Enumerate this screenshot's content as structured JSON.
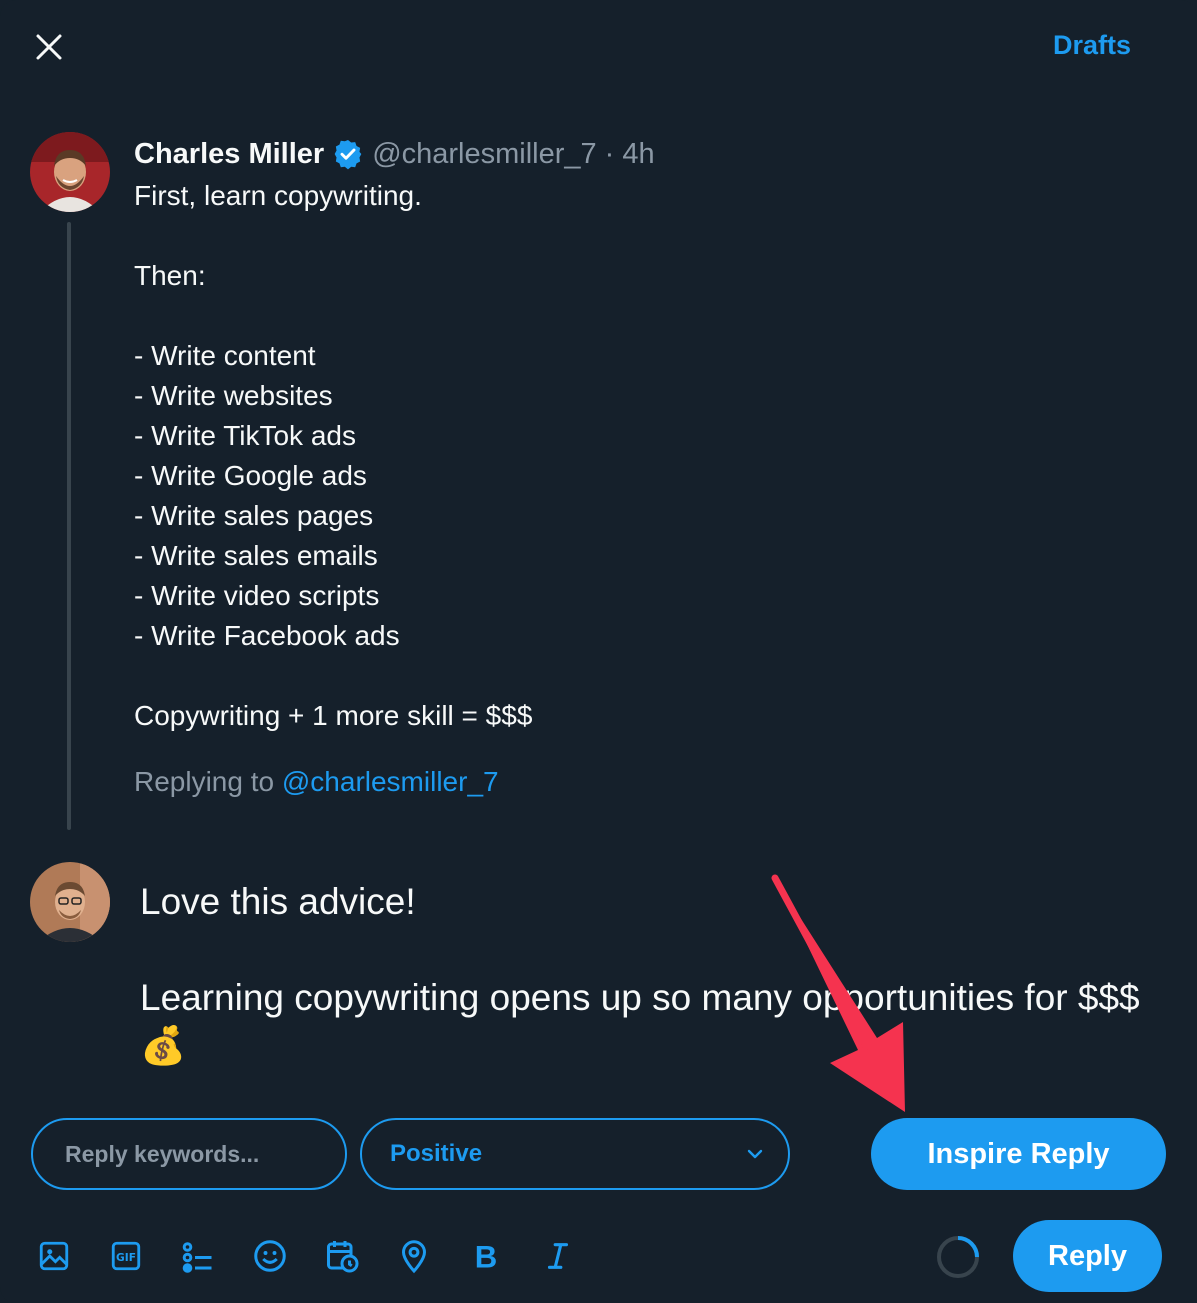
{
  "header": {
    "close_icon": "close-icon",
    "drafts_label": "Drafts"
  },
  "tweet": {
    "name": "Charles Miller",
    "verified_icon": "verified-badge-icon",
    "handle": "@charlesmiller_7",
    "dot": "·",
    "time": "4h",
    "lines": [
      "First, learn copywriting.",
      "",
      "Then:",
      "",
      "- Write content",
      "- Write websites",
      "- Write TikTok ads",
      "- Write Google ads",
      "- Write sales pages",
      "- Write sales emails",
      "- Write video scripts",
      "- Write Facebook ads",
      "",
      "Copywriting + 1 more skill = $$$"
    ],
    "replying_prefix": "Replying to",
    "replying_handle": "@charlesmiller_7"
  },
  "composer": {
    "line1": "Love this advice!",
    "line2": "Learning copywriting opens up so many opportunities for $$$ 💰"
  },
  "controls": {
    "keywords_placeholder": "Reply keywords...",
    "keywords_value": "",
    "tone_value": "Positive",
    "inspire_label": "Inspire Reply"
  },
  "toolbar": {
    "icons": [
      "image-icon",
      "gif-icon",
      "poll-icon",
      "emoji-icon",
      "schedule-icon",
      "location-icon",
      "bold-icon",
      "italic-icon"
    ],
    "reply_label": "Reply"
  },
  "colors": {
    "background": "#15202b",
    "accent": "#1d9bf0",
    "secondary_text": "#8b98a5",
    "annotation_arrow": "#f5334f"
  }
}
